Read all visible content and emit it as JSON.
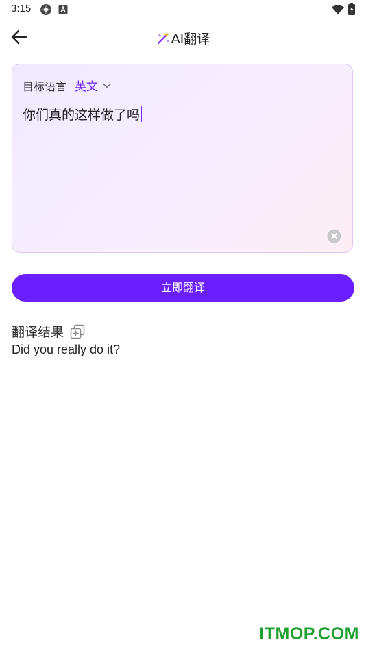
{
  "status_bar": {
    "time": "3:15",
    "icons": [
      "settings-flower-icon",
      "translate-a-icon",
      "wifi-icon",
      "battery-icon"
    ]
  },
  "app_bar": {
    "title": "AI翻译",
    "icons": [
      "back-arrow-icon",
      "magic-wand-icon"
    ],
    "accent_color": "#6a1fff"
  },
  "input_card": {
    "target_language_label": "目标语言",
    "target_language_value": "英文",
    "input_text": "你们真的这样做了吗",
    "icons": [
      "chevron-down-icon",
      "clear-icon"
    ]
  },
  "translate_button": {
    "label": "立即翻译"
  },
  "result": {
    "title": "翻译结果",
    "text": "Did you really do it?",
    "icons": [
      "copy-icon"
    ]
  },
  "watermark": {
    "text": "ITMOP.COM",
    "color": "#1fa031"
  }
}
